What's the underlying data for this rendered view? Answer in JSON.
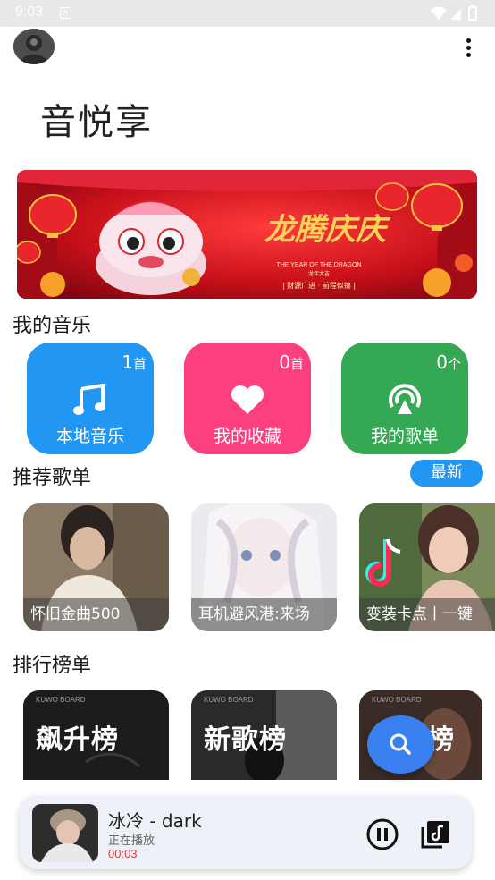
{
  "status_bar": {
    "time": "9:03",
    "notification_glyph": "A",
    "icons": [
      "wifi-icon",
      "signal-icon",
      "battery-icon"
    ]
  },
  "header": {
    "avatar_icon": "avatar-icon",
    "menu_icon": "more-vert-icon"
  },
  "app_title": "音悦享",
  "banner": {
    "headline": "龙腾庆庆",
    "line_en": "THE YEAR OF THE DRAGON",
    "line_cn": "龙年大吉",
    "tagline": "| 财源广进 · 前程似锦 |"
  },
  "my_music": {
    "title": "我的音乐",
    "tiles": [
      {
        "count": "1",
        "unit": "首",
        "label": "本地音乐",
        "icon": "music-note-icon",
        "color": "#2196f3"
      },
      {
        "count": "0",
        "unit": "首",
        "label": "我的收藏",
        "icon": "heart-icon",
        "color": "#fc3f7f"
      },
      {
        "count": "0",
        "unit": "个",
        "label": "我的歌单",
        "icon": "podcast-icon",
        "color": "#34a853"
      }
    ]
  },
  "recommended": {
    "title": "推荐歌单",
    "newest_label": "最新",
    "playlists": [
      {
        "caption": "怀旧金曲500"
      },
      {
        "caption": "耳机避风港:来场"
      },
      {
        "caption": "变装卡点丨一键"
      }
    ]
  },
  "charts": {
    "title": "排行榜单",
    "boards": [
      {
        "title": "飙升榜",
        "brand": "KUWO BOARD"
      },
      {
        "title": "新歌榜",
        "brand": "KUWO BOARD"
      },
      {
        "title": "热歌榜",
        "brand": "KUWO BOARD"
      }
    ]
  },
  "player": {
    "song": "冰冷 - dark",
    "state": "正在播放",
    "time": "00:03",
    "pause_icon": "pause-circle-icon",
    "playlist_icon": "queue-music-icon"
  },
  "fab": {
    "icon": "search-icon"
  }
}
